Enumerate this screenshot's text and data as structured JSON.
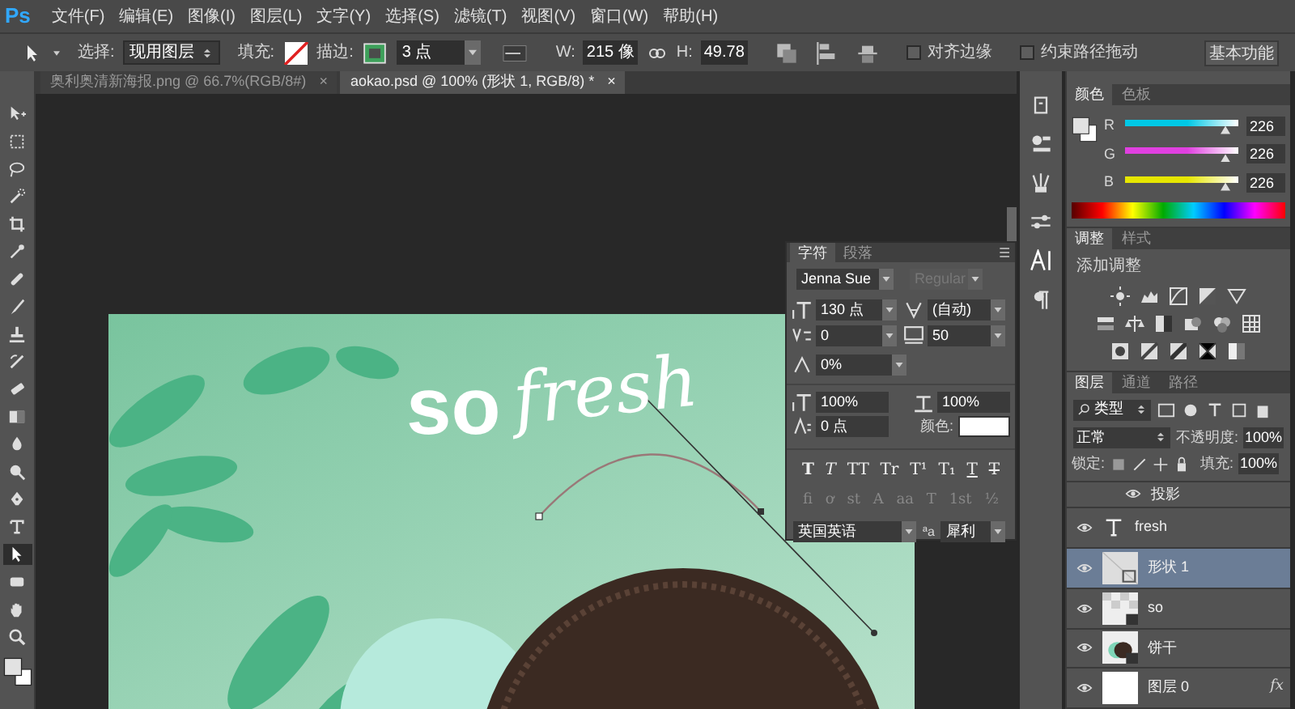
{
  "menu_bar": {
    "logo": "Ps",
    "items": [
      "文件(F)",
      "编辑(E)",
      "图像(I)",
      "图层(L)",
      "文字(Y)",
      "选择(S)",
      "滤镜(T)",
      "视图(V)",
      "窗口(W)",
      "帮助(H)"
    ]
  },
  "options_bar": {
    "select_label": "选择:",
    "select_value": "现用图层",
    "fill_label": "填充:",
    "stroke_label": "描边:",
    "stroke_width": "3 点",
    "w_label": "W:",
    "w_value": "215 像",
    "h_label": "H:",
    "h_value": "49.78",
    "align_edges": {
      "label": "对齐边缘",
      "checked": false
    },
    "constrain": {
      "label": "约束路径拖动",
      "checked": false
    },
    "workspace": "基本功能"
  },
  "document_tabs": [
    {
      "label": "奥利奥清新海报.png @ 66.7%(RGB/8#)",
      "close": "×",
      "selected": false
    },
    {
      "label": "aokao.psd @ 100% (形状 1, RGB/8) *",
      "close": "×",
      "selected": true
    }
  ],
  "tools": [
    {
      "kind": "move",
      "selected": false
    },
    {
      "kind": "marquee",
      "selected": false
    },
    {
      "kind": "lasso",
      "selected": false
    },
    {
      "kind": "quick",
      "selected": false
    },
    {
      "kind": "crop",
      "selected": false
    },
    {
      "kind": "eyedropper",
      "selected": false
    },
    {
      "kind": "heal",
      "selected": false
    },
    {
      "kind": "brush",
      "selected": false
    },
    {
      "kind": "stamp",
      "selected": false
    },
    {
      "kind": "history",
      "selected": false
    },
    {
      "kind": "eraser",
      "selected": false
    },
    {
      "kind": "gradient",
      "selected": false
    },
    {
      "kind": "blur",
      "selected": false
    },
    {
      "kind": "dodge",
      "selected": false
    },
    {
      "kind": "pen",
      "selected": false
    },
    {
      "kind": "type",
      "selected": false
    },
    {
      "kind": "path",
      "selected": true
    },
    {
      "kind": "shape",
      "selected": false
    },
    {
      "kind": "hand",
      "selected": false
    },
    {
      "kind": "zoom",
      "selected": false
    }
  ],
  "canvas": {
    "text_so": "so",
    "text_fresh": "fresh"
  },
  "character_panel": {
    "tabs": [
      {
        "label": "字符",
        "selected": true
      },
      {
        "label": "段落",
        "selected": false
      }
    ],
    "font_family": "Jenna Sue",
    "font_style": {
      "value": "Regular",
      "disabled": true
    },
    "size": "130 点",
    "leading": "(自动)",
    "kerning": "0",
    "tracking": "50",
    "proportional": "0%",
    "vertical_scale": "100%",
    "horizontal_scale": "100%",
    "baseline": "0 点",
    "color_label": "颜色:",
    "style_buttons": [
      {
        "label": "T",
        "kind": "bold"
      },
      {
        "label": "T",
        "kind": "italic"
      },
      {
        "label": "TT",
        "kind": "caps"
      },
      {
        "label": "Tr",
        "kind": "smallcaps"
      },
      {
        "label": "T¹",
        "kind": "super"
      },
      {
        "label": "T₁",
        "kind": "sub"
      },
      {
        "label": "T",
        "kind": "underline"
      },
      {
        "label": "T",
        "kind": "strike"
      }
    ],
    "opentype_buttons": [
      {
        "label": "fi",
        "disabled": true
      },
      {
        "label": "ơ",
        "disabled": true
      },
      {
        "label": "st",
        "disabled": true
      },
      {
        "label": "A",
        "disabled": true
      },
      {
        "label": "aa",
        "disabled": true
      },
      {
        "label": "T",
        "disabled": true
      },
      {
        "label": "1st",
        "disabled": true
      },
      {
        "label": "½",
        "disabled": true
      }
    ],
    "language": "英国英语",
    "antialias_label": "ªa",
    "antialias": "犀利"
  },
  "color_panel": {
    "tabs": [
      {
        "label": "颜色",
        "selected": true
      },
      {
        "label": "色板",
        "selected": false
      }
    ],
    "channels": [
      {
        "label": "R",
        "value": "226",
        "level": 0.886,
        "color": "#00c8e6"
      },
      {
        "label": "G",
        "value": "226",
        "level": 0.886,
        "color": "#e040e0"
      },
      {
        "label": "B",
        "value": "226",
        "level": 0.886,
        "color": "#e6e600"
      }
    ]
  },
  "adjustments_panel": {
    "tabs": [
      {
        "label": "调整",
        "selected": true
      },
      {
        "label": "样式",
        "selected": false
      }
    ],
    "title": "添加调整"
  },
  "layers_panel": {
    "tabs": [
      {
        "label": "图层",
        "selected": true
      },
      {
        "label": "通道",
        "selected": false
      },
      {
        "label": "路径",
        "selected": false
      }
    ],
    "filter": "类型",
    "blend_mode": "正常",
    "opacity_label": "不透明度:",
    "opacity": "100%",
    "lock_label": "锁定:",
    "fill_label": "填充:",
    "fill": "100%",
    "layers": [
      {
        "kind": "effect",
        "name": "投影",
        "visible": true,
        "selected": false
      },
      {
        "kind": "text",
        "name": "fresh",
        "visible": true,
        "selected": false
      },
      {
        "kind": "shape",
        "name": "形状 1",
        "visible": true,
        "selected": true
      },
      {
        "kind": "smart",
        "name": "so",
        "visible": true,
        "selected": false
      },
      {
        "kind": "smartimg",
        "name": "饼干",
        "visible": true,
        "selected": false
      },
      {
        "kind": "pixel",
        "name": "图层 0",
        "visible": true,
        "selected": false,
        "fx": "fx"
      }
    ]
  }
}
